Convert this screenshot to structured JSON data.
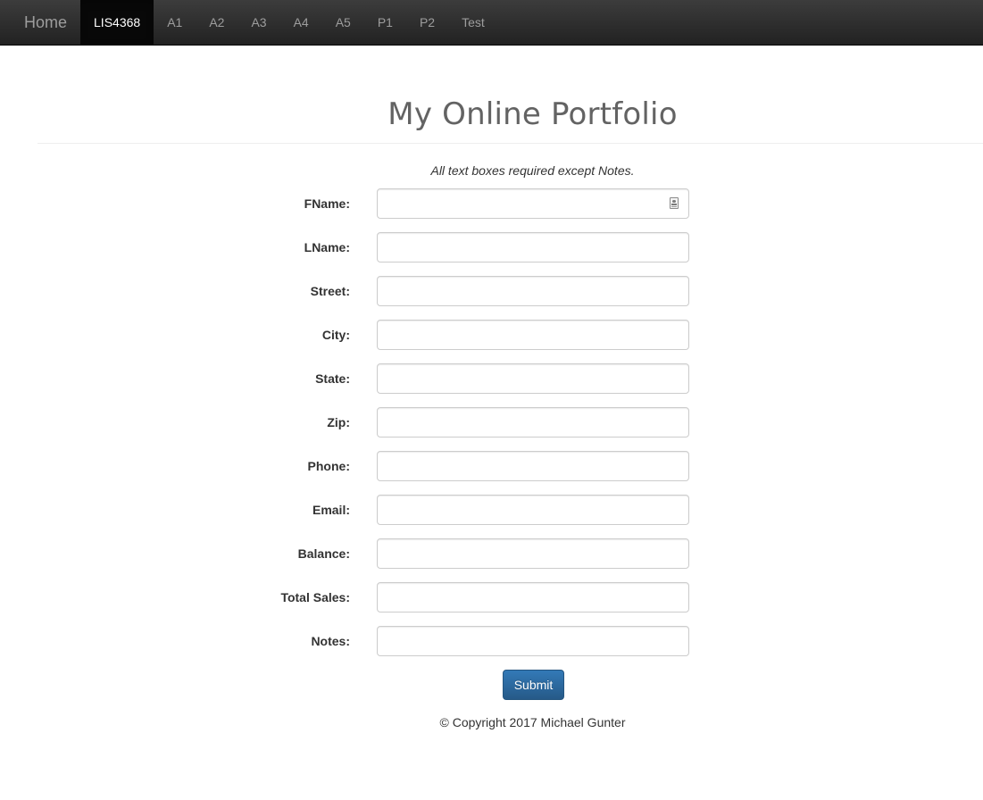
{
  "navbar": {
    "brand": "Home",
    "items": [
      {
        "label": "LIS4368",
        "active": true
      },
      {
        "label": "A1"
      },
      {
        "label": "A2"
      },
      {
        "label": "A3"
      },
      {
        "label": "A4"
      },
      {
        "label": "A5"
      },
      {
        "label": "P1"
      },
      {
        "label": "P2"
      },
      {
        "label": "Test"
      }
    ]
  },
  "page": {
    "title": "My Online Portfolio",
    "instructions": "All text boxes required except Notes."
  },
  "form": {
    "fields": [
      {
        "label": "FName:",
        "value": ""
      },
      {
        "label": "LName:",
        "value": ""
      },
      {
        "label": "Street:",
        "value": ""
      },
      {
        "label": "City:",
        "value": ""
      },
      {
        "label": "State:",
        "value": ""
      },
      {
        "label": "Zip:",
        "value": ""
      },
      {
        "label": "Phone:",
        "value": ""
      },
      {
        "label": "Email:",
        "value": ""
      },
      {
        "label": "Balance:",
        "value": ""
      },
      {
        "label": "Total Sales:",
        "value": ""
      },
      {
        "label": "Notes:",
        "value": ""
      }
    ],
    "submit_label": "Submit",
    "autofill_icon": "contact-card-icon"
  },
  "footer": {
    "copyright": "© Copyright 2017 Michael Gunter"
  },
  "colors": {
    "navbar_bg": "#222222",
    "nav_active_bg": "#080808",
    "nav_text": "#9d9d9d",
    "primary_button": "#337ab7",
    "title_text": "#636363"
  }
}
